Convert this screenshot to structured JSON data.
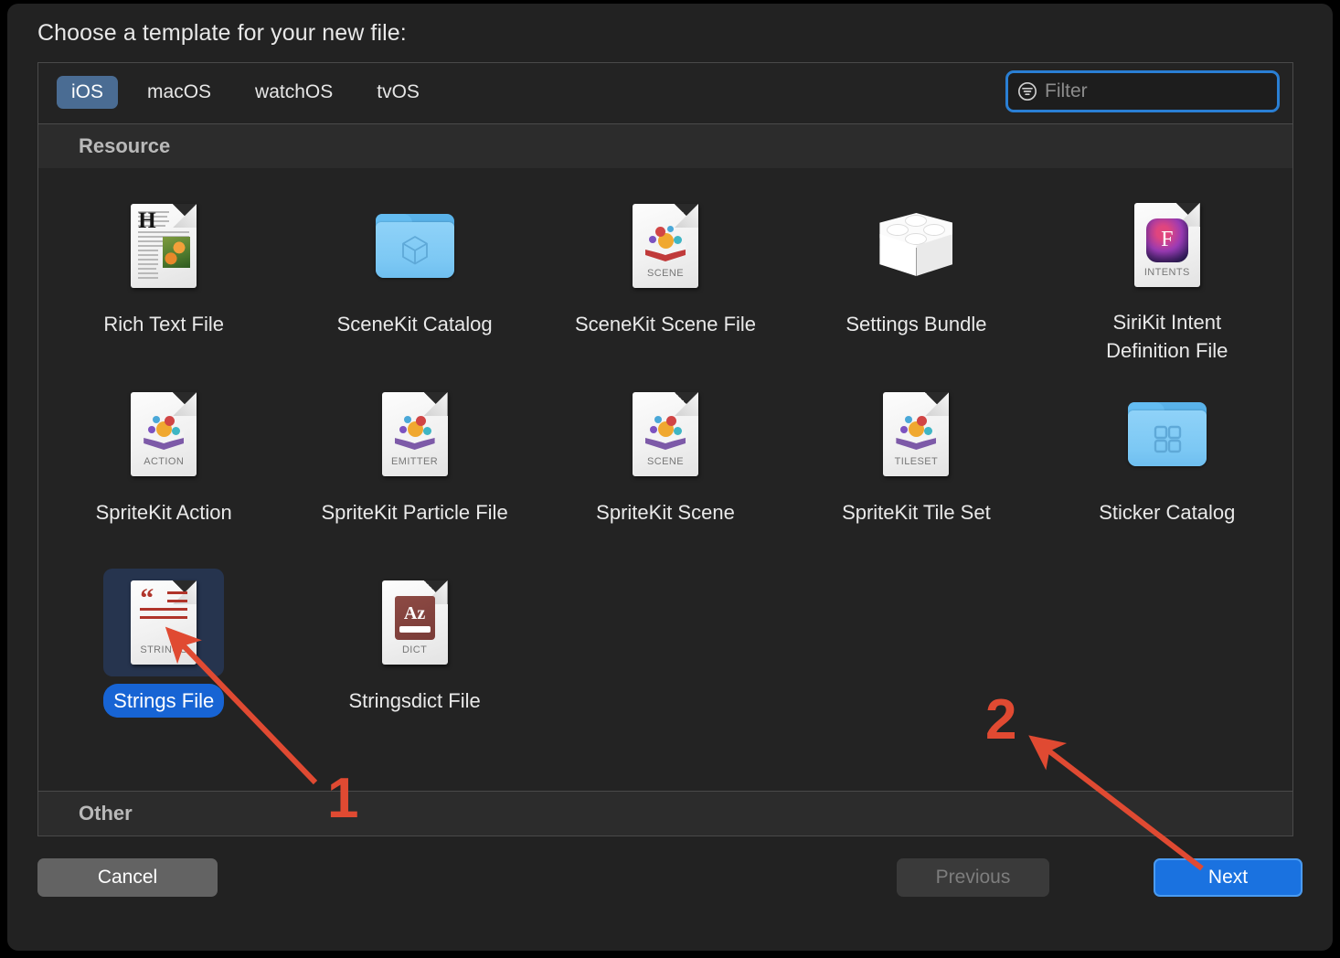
{
  "dialog": {
    "prompt": "Choose a template for your new file:"
  },
  "toolbar": {
    "platforms": [
      {
        "label": "iOS",
        "selected": true
      },
      {
        "label": "macOS",
        "selected": false
      },
      {
        "label": "watchOS",
        "selected": false
      },
      {
        "label": "tvOS",
        "selected": false
      }
    ],
    "filter": {
      "placeholder": "Filter",
      "value": "",
      "icon": "filter-icon",
      "focus_ring_color": "#2a7fd4"
    }
  },
  "sections": {
    "resource": {
      "title": "Resource"
    },
    "other": {
      "title": "Other"
    }
  },
  "templates": [
    {
      "label": "Rich Text File",
      "icon": "rich-text-file-icon",
      "badge": "",
      "selected": false
    },
    {
      "label": "SceneKit Catalog",
      "icon": "scenekit-catalog-folder-icon",
      "badge": "",
      "selected": false
    },
    {
      "label": "SceneKit Scene File",
      "icon": "scenekit-scene-file-icon",
      "badge": "SCENE",
      "selected": false
    },
    {
      "label": "Settings Bundle",
      "icon": "settings-bundle-icon",
      "badge": "",
      "selected": false
    },
    {
      "label": "SiriKit Intent Definition File",
      "icon": "sirikit-intent-definition-icon",
      "badge": "INTENTS",
      "selected": false
    },
    {
      "label": "SpriteKit Action",
      "icon": "spritekit-action-icon",
      "badge": "ACTION",
      "selected": false
    },
    {
      "label": "SpriteKit Particle File",
      "icon": "spritekit-particle-icon",
      "badge": "EMITTER",
      "selected": false
    },
    {
      "label": "SpriteKit Scene",
      "icon": "spritekit-scene-icon",
      "badge": "SCENE",
      "selected": false
    },
    {
      "label": "SpriteKit Tile Set",
      "icon": "spritekit-tileset-icon",
      "badge": "TILESET",
      "selected": false
    },
    {
      "label": "Sticker Catalog",
      "icon": "sticker-catalog-folder-icon",
      "badge": "",
      "selected": false
    },
    {
      "label": "Strings File",
      "icon": "strings-file-icon",
      "badge": "STRINGS",
      "selected": true
    },
    {
      "label": "Stringsdict File",
      "icon": "stringsdict-file-icon",
      "badge": "DICT",
      "selected": false
    }
  ],
  "footer": {
    "cancel_label": "Cancel",
    "previous_label": "Previous",
    "previous_disabled": true,
    "next_label": "Next",
    "next_accent": "#1a72e0"
  },
  "annotations": {
    "color": "#e04a32",
    "steps": [
      {
        "number": "1",
        "target": "strings-file-template"
      },
      {
        "number": "2",
        "target": "next-button"
      }
    ]
  }
}
